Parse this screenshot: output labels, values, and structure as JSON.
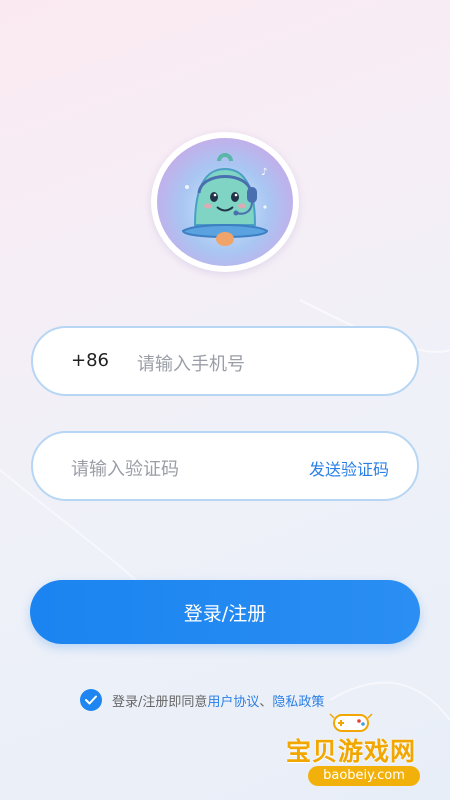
{
  "login": {
    "country_code": "+86",
    "phone_placeholder": "请输入手机号",
    "code_placeholder": "请输入验证码",
    "send_code_label": "发送验证码",
    "submit_label": "登录/注册",
    "agree_prefix": "登录/注册即同意",
    "user_agreement": "用户协议",
    "separator": "、",
    "privacy_policy": "隐私政策",
    "agreement_checked": true
  },
  "watermark": {
    "name": "宝贝游戏网",
    "url": "baobeiy.com"
  },
  "colors": {
    "accent": "#1f86f1",
    "link": "#2a7fe6",
    "field_border": "#b7d6f4",
    "watermark": "#f2a700"
  },
  "icons": {
    "logo": "bell-mascot-icon",
    "check": "check-icon",
    "watermark": "gamepad-icon"
  }
}
